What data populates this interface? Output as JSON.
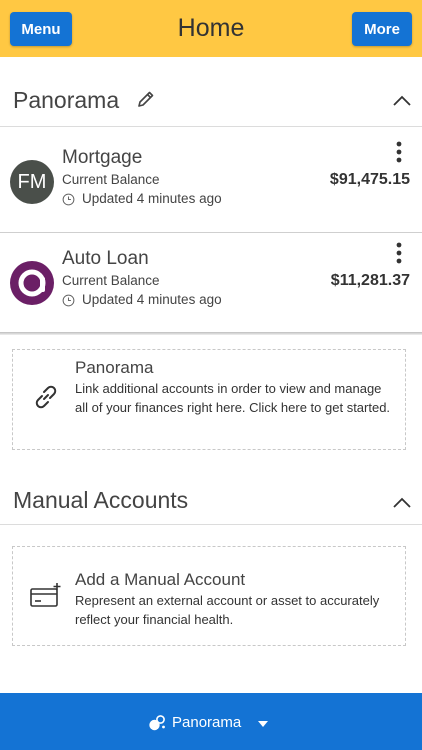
{
  "header": {
    "title": "Home",
    "menu_label": "Menu",
    "more_label": "More",
    "background_color": "#ffc843",
    "button_color": "#1473d4"
  },
  "panorama_section": {
    "title": "Panorama",
    "edit_icon": "pencil-icon",
    "collapse_icon": "chevron-up-icon",
    "accounts": [
      {
        "avatar_text": "FM",
        "name": "Mortgage",
        "balance_label": "Current Balance",
        "updated": "Updated 4 minutes ago",
        "amount": "$91,475.15"
      },
      {
        "avatar_icon": "ally-logo-icon",
        "name": "Auto Loan",
        "balance_label": "Current Balance",
        "updated": "Updated 4 minutes ago",
        "amount": "$11,281.37"
      }
    ],
    "link_card": {
      "icon": "link-icon",
      "title": "Panorama",
      "text": "Link additional accounts in order to view and manage all of your finances right here. Click here to get started."
    }
  },
  "manual_section": {
    "title": "Manual Accounts",
    "collapse_icon": "chevron-up-icon",
    "add_card": {
      "icon": "add-card-icon",
      "title": "Add a Manual Account",
      "text": "Represent an external account or asset to accurately reflect your financial health."
    }
  },
  "footer": {
    "label": "Panorama",
    "icon": "panorama-icon",
    "caret_icon": "caret-down-icon",
    "background_color": "#1473d4"
  }
}
